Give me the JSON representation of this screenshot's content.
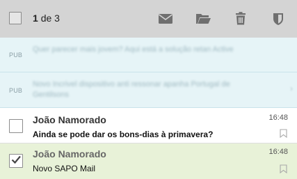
{
  "toolbar": {
    "count_current": "1",
    "count_rest": "de 3",
    "icons": [
      "envelope-icon",
      "folder-open-icon",
      "trash-icon",
      "shield-icon"
    ],
    "background": "#d4d4d4"
  },
  "ads": [
    {
      "tag": "PUB",
      "text": "Quer parecer mais jovem? Aqui está a solução retan Active"
    },
    {
      "tag": "PUB",
      "text": "Novo Incrivel dispositivo anti ressonar apanha Portugal de Gentilsons"
    }
  ],
  "messages": [
    {
      "sender": "João Namorado",
      "time": "16:48",
      "subject": "Ainda se pode dar os bons-dias à primavera?",
      "unread": true,
      "selected": false
    },
    {
      "sender": "João Namorado",
      "time": "16:48",
      "subject": "Novo SAPO Mail",
      "unread": false,
      "selected": true
    }
  ],
  "colors": {
    "ad_bg": "#e6f4f7",
    "selected_bg": "#e8f2d8",
    "icon": "#6f6f6f"
  }
}
